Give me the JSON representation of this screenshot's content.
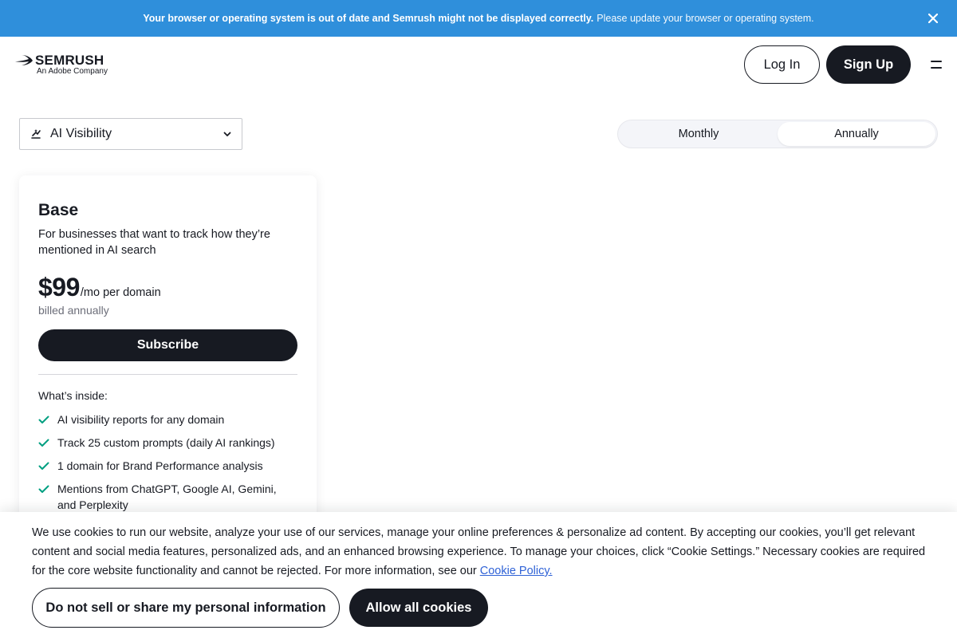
{
  "banner": {
    "bold_text": "Your browser or operating system is out of date and Semrush might not be displayed correctly.",
    "normal_text": "Please update your browser or operating system.",
    "background_color": "#2f8fdb",
    "close_icon": "close-icon"
  },
  "header": {
    "logo_text": "SEMRUSH",
    "logo_subtext": "An Adobe Company",
    "login_label": "Log In",
    "signup_label": "Sign Up",
    "menu_icon": "hamburger-menu-icon"
  },
  "product_select": {
    "icon": "ai-visibility-icon",
    "selected": "AI Visibility"
  },
  "billing_toggle": {
    "options": [
      "Monthly",
      "Annually"
    ],
    "selected": "Annually"
  },
  "plan": {
    "name": "Base",
    "description": "For businesses that want to track how they’re mentioned in AI search",
    "price": "$99",
    "price_unit": "/mo per domain",
    "billing_note": "billed annually",
    "cta": "Subscribe",
    "features_heading": "What’s inside:",
    "features": [
      "AI visibility reports for any domain",
      "Track 25 custom prompts (daily AI rankings)",
      "1 domain for Brand Performance analysis",
      "Mentions from ChatGPT, Google AI, Gemini, and Perplexity"
    ],
    "check_color": "#009f81"
  },
  "cookie": {
    "text": "We use cookies to run our website, analyze your use of our services, manage your online preferences & personalize ad content. By accepting our cookies, you’ll get relevant content and social media features, personalized ads, and an enhanced browsing experience. To manage your choices, click “Cookie Settings.” Necessary cookies are required for the core website functionality and cannot be rejected. For more information, see our",
    "link_text": "Cookie Policy.",
    "do_not_sell_label": "Do not sell or share my personal information",
    "allow_label": "Allow all cookies"
  }
}
